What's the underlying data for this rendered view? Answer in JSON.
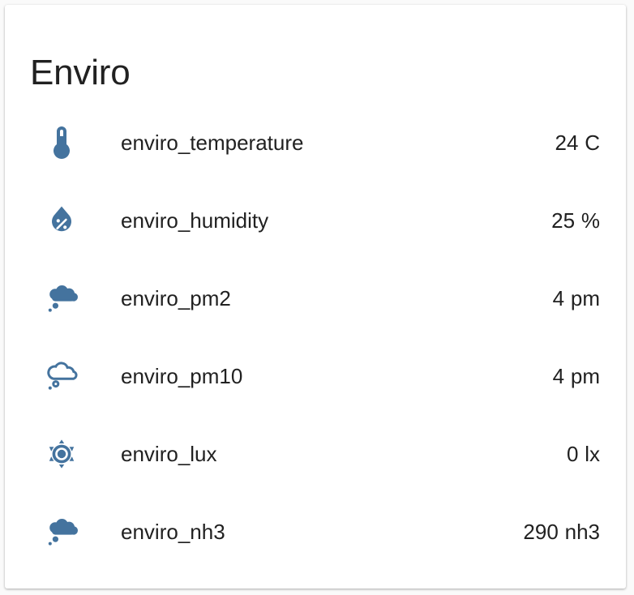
{
  "card": {
    "title": "Enviro"
  },
  "accent_color": "#44739e",
  "entities": [
    {
      "icon": "thermometer-icon",
      "name": "enviro_temperature",
      "value": "24",
      "unit": "C"
    },
    {
      "icon": "water-percent-icon",
      "name": "enviro_humidity",
      "value": "25",
      "unit": "%"
    },
    {
      "icon": "weather-fog-cloud-icon",
      "name": "enviro_pm2",
      "value": "4",
      "unit": "pm"
    },
    {
      "icon": "cloud-outline-icon",
      "name": "enviro_pm10",
      "value": "4",
      "unit": "pm"
    },
    {
      "icon": "brightness-sun-icon",
      "name": "enviro_lux",
      "value": "0",
      "unit": "lx"
    },
    {
      "icon": "weather-fog-cloud-icon",
      "name": "enviro_nh3",
      "value": "290",
      "unit": "nh3"
    }
  ]
}
